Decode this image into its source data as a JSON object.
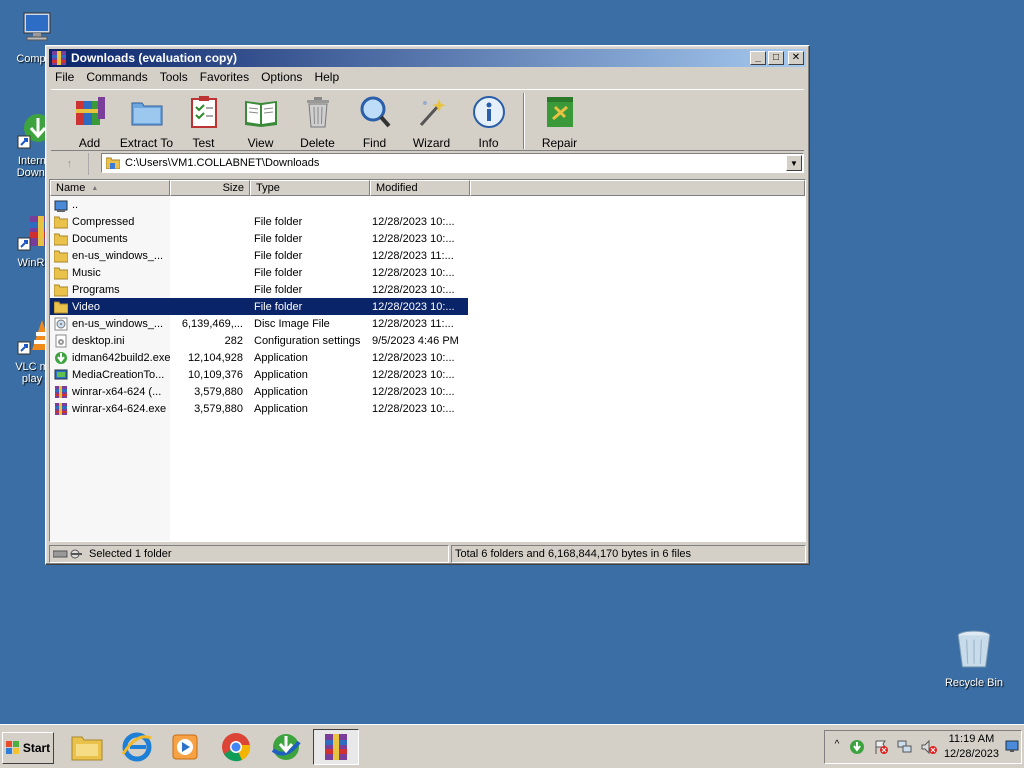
{
  "desktop": {
    "icons": [
      {
        "label": "Comp",
        "icon": "computer-icon"
      },
      {
        "label": "Intern Downl",
        "icon": "internet-download-manager-icon"
      },
      {
        "label": "WinR",
        "icon": "winrar-icon"
      },
      {
        "label": "VLC m play",
        "icon": "vlc-icon"
      },
      {
        "label": "Recycle Bin",
        "icon": "recycle-bin-icon"
      }
    ]
  },
  "window": {
    "title": "Downloads (evaluation copy)",
    "menu": [
      "File",
      "Commands",
      "Tools",
      "Favorites",
      "Options",
      "Help"
    ],
    "toolbar": [
      {
        "label": "Add",
        "icon": "add-archive-icon"
      },
      {
        "label": "Extract To",
        "icon": "extract-to-icon"
      },
      {
        "label": "Test",
        "icon": "test-icon"
      },
      {
        "label": "View",
        "icon": "view-book-icon"
      },
      {
        "label": "Delete",
        "icon": "trash-icon"
      },
      {
        "label": "Find",
        "icon": "magnifier-icon"
      },
      {
        "label": "Wizard",
        "icon": "wizard-wand-icon"
      },
      {
        "label": "Info",
        "icon": "info-icon"
      },
      {
        "label": "Repair",
        "icon": "repair-icon"
      }
    ],
    "address": "C:\\Users\\VM1.COLLABNET\\Downloads",
    "columns": {
      "name": "Name",
      "size": "Size",
      "type": "Type",
      "modified": "Modified"
    },
    "files": [
      {
        "name": "..",
        "size": "",
        "type": "",
        "modified": "",
        "icon": "parent-dir-icon"
      },
      {
        "name": "Compressed",
        "size": "",
        "type": "File folder",
        "modified": "12/28/2023 10:...",
        "icon": "folder-icon"
      },
      {
        "name": "Documents",
        "size": "",
        "type": "File folder",
        "modified": "12/28/2023 10:...",
        "icon": "folder-icon"
      },
      {
        "name": "en-us_windows_...",
        "size": "",
        "type": "File folder",
        "modified": "12/28/2023 11:...",
        "icon": "folder-icon"
      },
      {
        "name": "Music",
        "size": "",
        "type": "File folder",
        "modified": "12/28/2023 10:...",
        "icon": "folder-icon"
      },
      {
        "name": "Programs",
        "size": "",
        "type": "File folder",
        "modified": "12/28/2023 10:...",
        "icon": "folder-icon"
      },
      {
        "name": "Video",
        "size": "",
        "type": "File folder",
        "modified": "12/28/2023 10:...",
        "icon": "folder-icon",
        "selected": true
      },
      {
        "name": "en-us_windows_...",
        "size": "6,139,469,...",
        "type": "Disc Image File",
        "modified": "12/28/2023 11:...",
        "icon": "disc-image-icon"
      },
      {
        "name": "desktop.ini",
        "size": "282",
        "type": "Configuration settings",
        "modified": "9/5/2023 4:46 PM",
        "icon": "ini-file-icon"
      },
      {
        "name": "idman642build2.exe",
        "size": "12,104,928",
        "type": "Application",
        "modified": "12/28/2023 10:...",
        "icon": "idm-exe-icon"
      },
      {
        "name": "MediaCreationTo...",
        "size": "10,109,376",
        "type": "Application",
        "modified": "12/28/2023 10:...",
        "icon": "media-creation-icon"
      },
      {
        "name": "winrar-x64-624 (...",
        "size": "3,579,880",
        "type": "Application",
        "modified": "12/28/2023 10:...",
        "icon": "winrar-exe-icon"
      },
      {
        "name": "winrar-x64-624.exe",
        "size": "3,579,880",
        "type": "Application",
        "modified": "12/28/2023 10:...",
        "icon": "winrar-exe-icon"
      }
    ],
    "status_left": "Selected 1 folder",
    "status_right": "Total 6 folders and 6,168,844,170 bytes in 6 files"
  },
  "taskbar": {
    "start": "Start",
    "apps": [
      "file-explorer-icon",
      "internet-explorer-icon",
      "media-player-icon",
      "chrome-icon",
      "idm-icon",
      "winrar-icon"
    ],
    "clock_time": "11:19 AM",
    "clock_date": "12/28/2023"
  }
}
